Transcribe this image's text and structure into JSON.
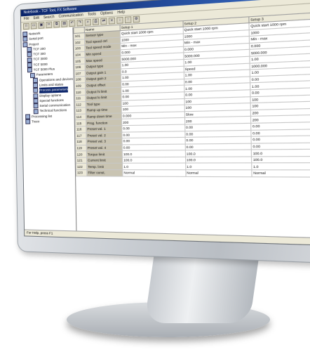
{
  "window": {
    "title": "Notebook - TCF Tool, FX Software"
  },
  "menu": [
    "File",
    "Edit",
    "Search",
    "Communication",
    "Tools",
    "Options",
    "Help"
  ],
  "toolbar_icons": [
    "new-icon",
    "open-icon",
    "save-icon",
    "cut-icon",
    "copy-icon",
    "paste-icon",
    "undo-icon",
    "redo-icon",
    "find-icon",
    "print-icon",
    "connect-icon",
    "disconnect-icon",
    "download-icon",
    "upload-icon",
    "settings-icon"
  ],
  "tree": [
    "Network",
    "Serial port",
    "Project",
    "TCF 200",
    "TCF 300",
    "TCF 3000",
    "TCF 5000",
    "TCF 5000 Plus",
    "Parameters",
    "Operations and devices",
    "Limits and states",
    "Process parameters",
    "Display options",
    "Special functions",
    "Serial communication",
    "Technical functions",
    "Processing list",
    "Trace"
  ],
  "tree_selected": 11,
  "grid": {
    "columns": [
      "",
      "Name",
      "Setup 1",
      "Setup 2",
      "Setup 3"
    ],
    "rows": [
      [
        "101",
        "Sensor type",
        "Quick start 1000 rpm",
        "Quick start 1000 rpm",
        "Quick start 1000 rpm"
      ],
      [
        "102",
        "Tool speed ctrl",
        "1000",
        "1000",
        "1000"
      ],
      [
        "103",
        "Tool speed mode",
        "Min - max",
        "Min - max",
        "Min - max"
      ],
      [
        "104",
        "Min speed",
        "0.000",
        "0.000",
        "0.000"
      ],
      [
        "105",
        "Max speed",
        "5000.000",
        "5000.000",
        "5000.000"
      ],
      [
        "106",
        "Output type",
        "1.00",
        "1.00",
        "1.00"
      ],
      [
        "107",
        "Output gain 1",
        "0.0",
        "Speed",
        "1000.000"
      ],
      [
        "108",
        "Output gain 2",
        "1.00",
        "1.00",
        "1.00"
      ],
      [
        "109",
        "Output offset",
        "0.00",
        "0.00",
        "0.00"
      ],
      [
        "110",
        "Output hi limit",
        "1.00",
        "1.00",
        "1.00"
      ],
      [
        "111",
        "Output lo limit",
        "0.00",
        "0.00",
        "0.00"
      ],
      [
        "112",
        "Tool type",
        "100",
        "100",
        "100"
      ],
      [
        "113",
        "Ramp up time",
        "100",
        "100",
        "100"
      ],
      [
        "114",
        "Ramp down time",
        "0.000",
        "Slow",
        "200"
      ],
      [
        "115",
        "Prog. function",
        "200",
        "200",
        "200"
      ],
      [
        "116",
        "Preset val. 1",
        "0.00",
        "0.00",
        "0.00"
      ],
      [
        "117",
        "Preset val. 2",
        "0.00",
        "0.00",
        "0.00"
      ],
      [
        "118",
        "Preset val. 3",
        "0.00",
        "0.00",
        "0.00"
      ],
      [
        "119",
        "Preset val. 4",
        "0.00",
        "0.00",
        "0.00"
      ],
      [
        "120",
        "Torque limit",
        "100.0",
        "100.0",
        "100.0"
      ],
      [
        "121",
        "Current limit",
        "100.0",
        "100.0",
        "100.0"
      ],
      [
        "122",
        "Temp. limit",
        "1.0",
        "1.0",
        "1.0"
      ],
      [
        "123",
        "Filter const.",
        "Normal",
        "Normal",
        "Normal"
      ]
    ]
  },
  "status": {
    "text": "For Help, press F1"
  },
  "brand": {
    "logo_glyph": ""
  }
}
